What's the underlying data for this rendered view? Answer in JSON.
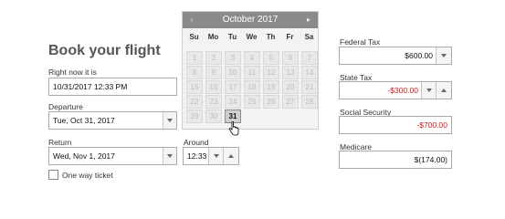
{
  "form": {
    "title": "Book your flight",
    "now_label": "Right now it is",
    "now_value": "10/31/2017 12:33 PM",
    "departure_label": "Departure",
    "departure_value": "Tue, Oct 31, 2017",
    "return_label": "Return",
    "return_value": "Wed, Nov 1, 2017",
    "around_label": "Around",
    "around_value": "12:33",
    "one_way_label": "One way ticket"
  },
  "calendar": {
    "month": "October 2017",
    "prev_icon": "‹",
    "next_icon": "▸",
    "weekdays": [
      "Su",
      "Mo",
      "Tu",
      "We",
      "Th",
      "Fr",
      "Sa"
    ],
    "days": [
      [
        "1",
        "2",
        "3",
        "4",
        "5",
        "6",
        "7"
      ],
      [
        "8",
        "9",
        "10",
        "11",
        "12",
        "13",
        "14"
      ],
      [
        "15",
        "16",
        "17",
        "18",
        "19",
        "20",
        "21"
      ],
      [
        "22",
        "23",
        "24",
        "25",
        "26",
        "27",
        "28"
      ],
      [
        "29",
        "30",
        "31"
      ]
    ],
    "selected": "31"
  },
  "taxes": {
    "federal_label": "Federal Tax",
    "federal_value": "$600.00",
    "state_label": "State Tax",
    "state_value": "-$300.00",
    "social_label": "Social Security",
    "social_value": "-$700.00",
    "medicare_label": "Medicare",
    "medicare_value": "$(174.00)"
  },
  "colors": {
    "negative": "#d01a1a",
    "calendar_header": "#8a8a8a"
  }
}
